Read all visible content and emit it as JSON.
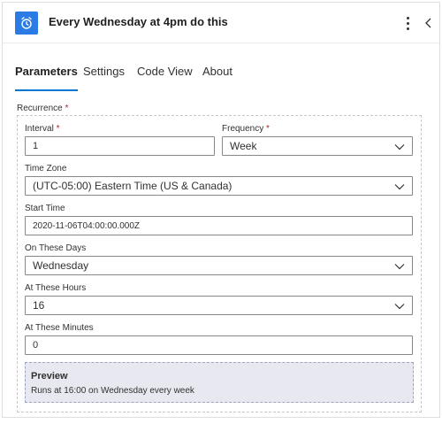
{
  "header": {
    "title": "Every Wednesday at 4pm do this",
    "icon": "alarm-clock-icon",
    "accent": "#2b7be4"
  },
  "tabs": [
    {
      "label": "Parameters",
      "active": true
    },
    {
      "label": "Settings",
      "active": false
    },
    {
      "label": "Code View",
      "active": false
    },
    {
      "label": "About",
      "active": false
    }
  ],
  "recurrence": {
    "label": "Recurrence",
    "required_mark": "*",
    "interval": {
      "label": "Interval",
      "required_mark": "*",
      "value": "1"
    },
    "frequency": {
      "label": "Frequency",
      "required_mark": "*",
      "value": "Week"
    },
    "time_zone": {
      "label": "Time Zone",
      "value": "(UTC-05:00) Eastern Time (US & Canada)"
    },
    "start_time": {
      "label": "Start Time",
      "value": "2020-11-06T04:00:00.000Z"
    },
    "on_these_days": {
      "label": "On These Days",
      "value": "Wednesday"
    },
    "at_these_hours": {
      "label": "At These Hours",
      "value": "16"
    },
    "at_these_minutes": {
      "label": "At These Minutes",
      "value": "0"
    },
    "preview": {
      "title": "Preview",
      "text": "Runs at 16:00 on Wednesday every week"
    }
  }
}
